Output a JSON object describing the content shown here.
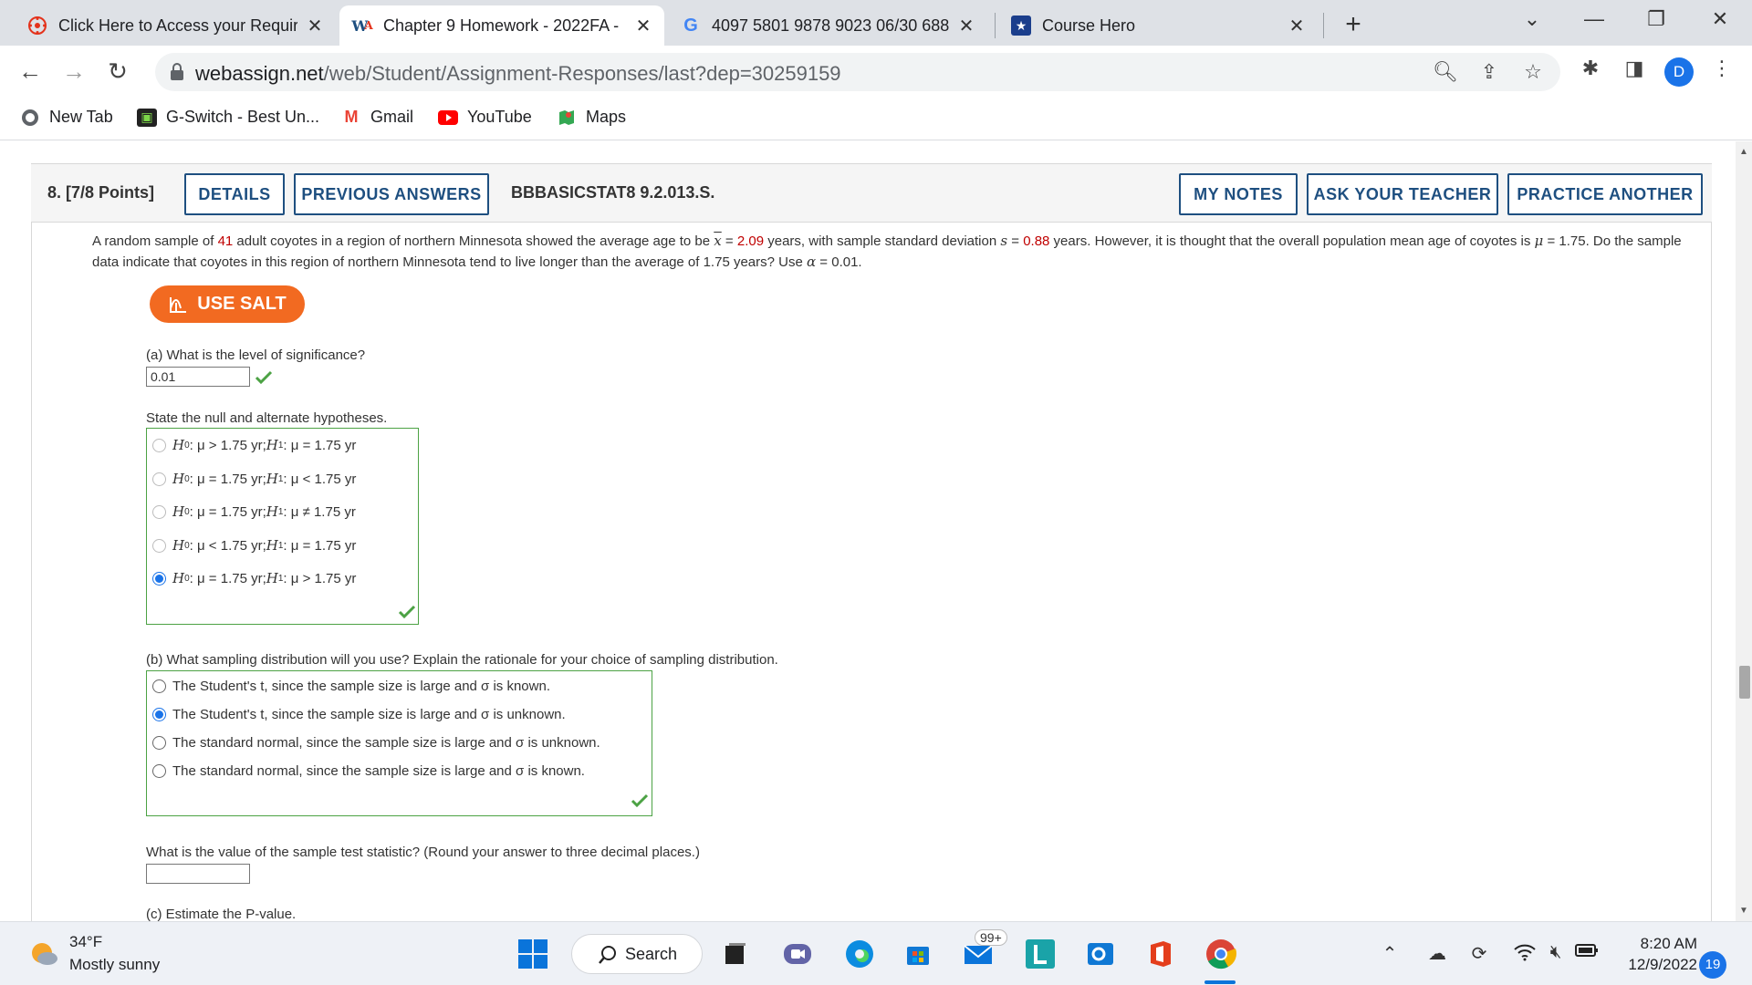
{
  "browser": {
    "tabs": [
      {
        "title": "Click Here to Access your Require",
        "active": false
      },
      {
        "title": "Chapter 9 Homework - 2022FA -",
        "active": true
      },
      {
        "title": "4097 5801 9878 9023 06/30 688",
        "active": false
      },
      {
        "title": "Course Hero",
        "active": false
      }
    ],
    "url_host": "webassign.net",
    "url_path": "/web/Student/Assignment-Responses/last?dep=30259159",
    "profile_initial": "D",
    "bookmarks": [
      "New Tab",
      "G-Switch - Best Un...",
      "Gmail",
      "YouTube",
      "Maps"
    ]
  },
  "question": {
    "number": "8.",
    "points": "[7/8 Points]",
    "details_label": "DETAILS",
    "previous_label": "PREVIOUS ANSWERS",
    "code": "BBBASICSTAT8 9.2.013.S.",
    "my_notes_label": "MY NOTES",
    "ask_teacher_label": "ASK YOUR TEACHER",
    "practice_label": "PRACTICE ANOTHER",
    "problem": {
      "p1": "A random sample of ",
      "n": "41",
      "p2": " adult coyotes in a region of northern Minnesota showed the average age to be ",
      "xbar_sym": "x",
      "eq1": " = ",
      "xbar_val": "2.09",
      "p3": " years, with sample standard deviation ",
      "s_sym": "s",
      "eq2": " = ",
      "s_val": "0.88",
      "p4": " years. However, it is thought that the overall population mean age of coyotes is ",
      "mu_sym": "μ",
      "p5": " = 1.75. Do the sample data indicate that coyotes in this region of northern Minnesota tend to live longer than the average of 1.75 years? Use ",
      "alpha_sym": "α",
      "p6": " = 0.01."
    },
    "salt_label": "USE SALT",
    "part_a": {
      "prompt": "(a) What is the level of significance?",
      "answer": "0.01"
    },
    "hypotheses": {
      "prompt": "State the null and alternate hypotheses.",
      "options": [
        {
          "h0": ": μ > 1.75 yr; ",
          "h1": ": μ = 1.75 yr"
        },
        {
          "h0": ": μ = 1.75 yr; ",
          "h1": ": μ < 1.75 yr"
        },
        {
          "h0": ": μ = 1.75 yr; ",
          "h1": ": μ ≠ 1.75 yr"
        },
        {
          "h0": ": μ < 1.75 yr; ",
          "h1": ": μ = 1.75 yr"
        },
        {
          "h0": ": μ = 1.75 yr; ",
          "h1": ": μ > 1.75 yr"
        }
      ],
      "selected_index": 4,
      "h_letter": "H",
      "sub0": "0",
      "sub1": "1"
    },
    "part_b": {
      "prompt": "(b) What sampling distribution will you use? Explain the rationale for your choice of sampling distribution.",
      "options": [
        "The Student's t, since the sample size is large and σ is known.",
        "The Student's t, since the sample size is large and σ is unknown.",
        "The standard normal, since the sample size is large and σ is unknown.",
        "The standard normal, since the sample size is large and σ is known."
      ],
      "selected_index": 1
    },
    "test_stat_prompt": "What is the value of the sample test statistic? (Round your answer to three decimal places.)",
    "test_stat_value": "",
    "part_c_prompt": "(c) Estimate the P-value."
  },
  "taskbar": {
    "temp": "34°F",
    "weather": "Mostly sunny",
    "search_label": "Search",
    "mail_badge": "99+",
    "time": "8:20 AM",
    "date": "12/9/2022",
    "notifications": "19"
  },
  "colors": {
    "accent_blue": "#1e4f80",
    "salt_orange": "#f26a21",
    "correct_green": "#4ca244",
    "value_red": "#c00000"
  }
}
